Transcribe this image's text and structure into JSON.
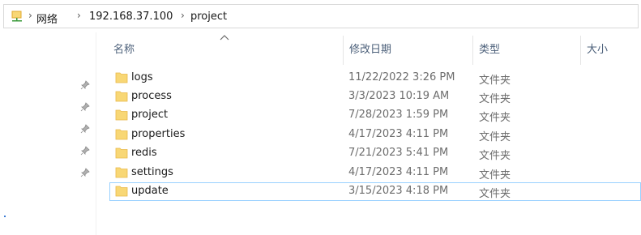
{
  "address_bar": {
    "icon": "network-drive-icon",
    "crumbs": [
      "网络",
      "192.168.37.100",
      "project"
    ]
  },
  "columns": {
    "name": "名称",
    "date": "修改日期",
    "type": "类型",
    "size": "大小"
  },
  "files": [
    {
      "name": "logs",
      "date": "11/22/2022 3:26 PM",
      "type": "文件夹"
    },
    {
      "name": "process",
      "date": "3/3/2023 10:19 AM",
      "type": "文件夹"
    },
    {
      "name": "project",
      "date": "7/28/2023 1:59 PM",
      "type": "文件夹"
    },
    {
      "name": "properties",
      "date": "4/17/2023 4:11 PM",
      "type": "文件夹"
    },
    {
      "name": "redis",
      "date": "7/21/2023 5:41 PM",
      "type": "文件夹"
    },
    {
      "name": "settings",
      "date": "4/17/2023 4:11 PM",
      "type": "文件夹"
    },
    {
      "name": "update",
      "date": "3/15/2023 4:18 PM",
      "type": "文件夹"
    }
  ],
  "colors": {
    "folder": "#f8d775",
    "folder_dark": "#e9b949",
    "selection_border": "#99d1ff",
    "header_text": "#4c607a"
  }
}
